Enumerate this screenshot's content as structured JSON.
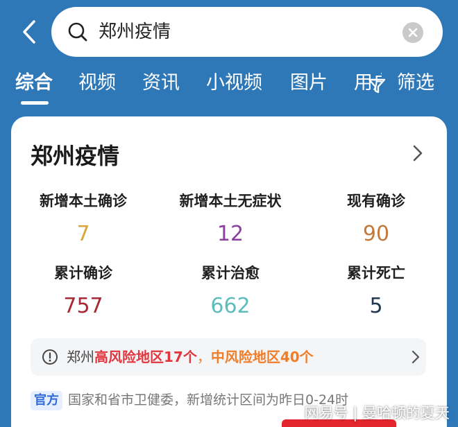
{
  "search": {
    "query": "郑州疫情"
  },
  "tabs": [
    {
      "label": "综合",
      "active": true
    },
    {
      "label": "视频",
      "active": false
    },
    {
      "label": "资讯",
      "active": false
    },
    {
      "label": "小视频",
      "active": false
    },
    {
      "label": "图片",
      "active": false
    },
    {
      "label": "用户",
      "active": false
    }
  ],
  "filter_label": "筛选",
  "card": {
    "title": "郑州疫情",
    "stats": [
      {
        "label": "新增本土确诊",
        "value": "7",
        "color": "#d9a63a"
      },
      {
        "label": "新增本土无症状",
        "value": "12",
        "color": "#8d3fa0"
      },
      {
        "label": "现有确诊",
        "value": "90",
        "color": "#c4793a"
      },
      {
        "label": "累计确诊",
        "value": "757",
        "color": "#a72a36"
      },
      {
        "label": "累计治愈",
        "value": "662",
        "color": "#5dbdbd"
      },
      {
        "label": "累计死亡",
        "value": "5",
        "color": "#223a4f"
      }
    ],
    "notice": {
      "prefix": "郑州",
      "high_risk": "高风险地区17个",
      "separator": "，",
      "mid_risk": "中风险地区40个"
    },
    "source_badge": "官方",
    "source_text": "国家和省市卫健委，新增统计区间为昨日0-24时"
  },
  "watermark": "网易号 | 曼哈顿的夏天",
  "colors": {
    "header_bg": "#2f78b8",
    "high_risk": "#e2363e",
    "mid_risk": "#f07d2a"
  }
}
